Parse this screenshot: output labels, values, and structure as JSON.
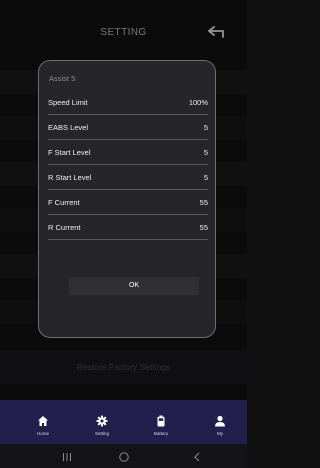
{
  "header": {
    "title": "SETTING"
  },
  "background": {
    "restore_label": "Restore Factory Settings"
  },
  "dialog": {
    "title": "Assist 5",
    "rows": [
      {
        "label": "Speed Limit",
        "value": "100%"
      },
      {
        "label": "EABS Level",
        "value": "5"
      },
      {
        "label": "F Start Level",
        "value": "5"
      },
      {
        "label": "R Start Level",
        "value": "5"
      },
      {
        "label": "F Current",
        "value": "55"
      },
      {
        "label": "R Current",
        "value": "55"
      }
    ],
    "ok_label": "OK"
  },
  "tabbar": {
    "tabs": [
      {
        "label": "Home",
        "icon": "home-icon"
      },
      {
        "label": "Setting",
        "icon": "gear-icon"
      },
      {
        "label": "Battery",
        "icon": "battery-icon"
      },
      {
        "label": "My",
        "icon": "user-icon"
      }
    ]
  },
  "system_nav": {
    "buttons": [
      "recents-icon",
      "home-circle-icon",
      "back-chevron-icon"
    ]
  },
  "colors": {
    "tabbar_bg": "#221f4d",
    "dialog_bg": "#262629",
    "dialog_border": "#6d6d72"
  }
}
